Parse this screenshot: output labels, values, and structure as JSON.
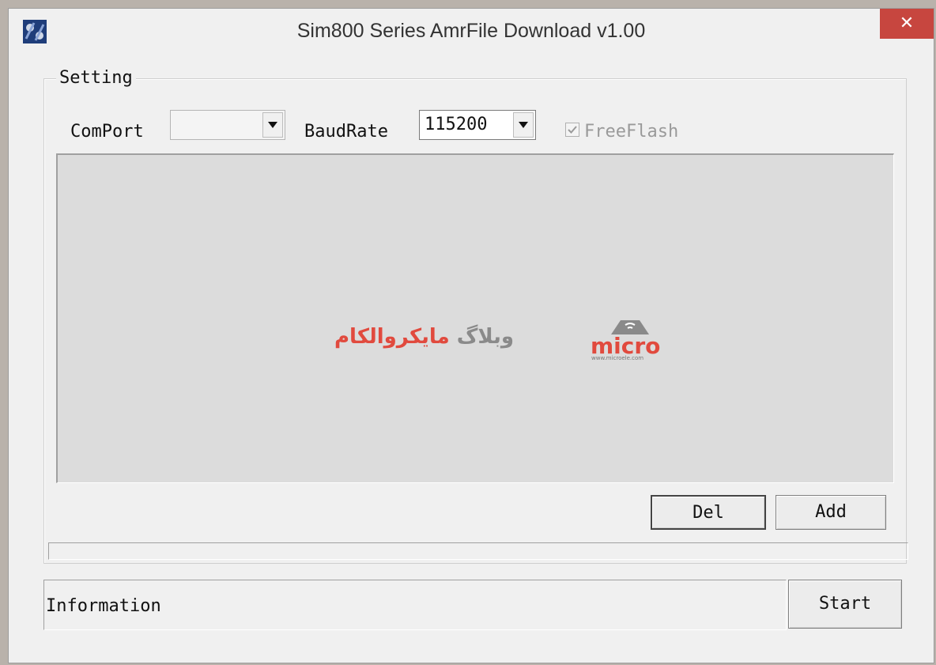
{
  "window": {
    "title": "Sim800 Series AmrFile Download v1.00",
    "close_glyph": "✕",
    "icon": "app-icon"
  },
  "setting": {
    "group_label": "Setting",
    "comport_label": "ComPort",
    "comport_value": "",
    "baudrate_label": "BaudRate",
    "baudrate_value": "115200",
    "freeflash_label": "FreeFlash",
    "freeflash_checked": true
  },
  "file_list": {
    "items": [],
    "watermark_text_red": "مایکروالکام",
    "watermark_text_gray": "وبلاگ",
    "watermark_logo": "micro",
    "watermark_url": "www.microele.com"
  },
  "buttons": {
    "del_label": "Del",
    "add_label": "Add",
    "start_label": "Start"
  },
  "progress": {
    "value": 0
  },
  "status": {
    "information": "Information"
  },
  "colors": {
    "close_button": "#c7463f",
    "window_bg": "#f0f0f0",
    "list_bg": "#dcdcdc",
    "watermark_red": "#e14a3e"
  }
}
